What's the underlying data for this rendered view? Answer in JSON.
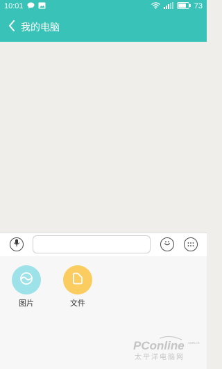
{
  "status_bar": {
    "time": "10:01",
    "battery": "73"
  },
  "nav": {
    "title": "我的电脑"
  },
  "input_bar": {
    "placeholder": ""
  },
  "panel": {
    "items": [
      {
        "label": "图片",
        "icon": "image-icon",
        "color": "#9de2e8"
      },
      {
        "label": "文件",
        "icon": "file-icon",
        "color": "#fbcd60"
      }
    ]
  },
  "colors": {
    "accent": "#39c3b8",
    "chat_bg": "#efeeeb"
  },
  "watermark": {
    "brand": "PConline",
    "subtitle": "太平洋电脑网",
    "domain": ".com.cn"
  }
}
